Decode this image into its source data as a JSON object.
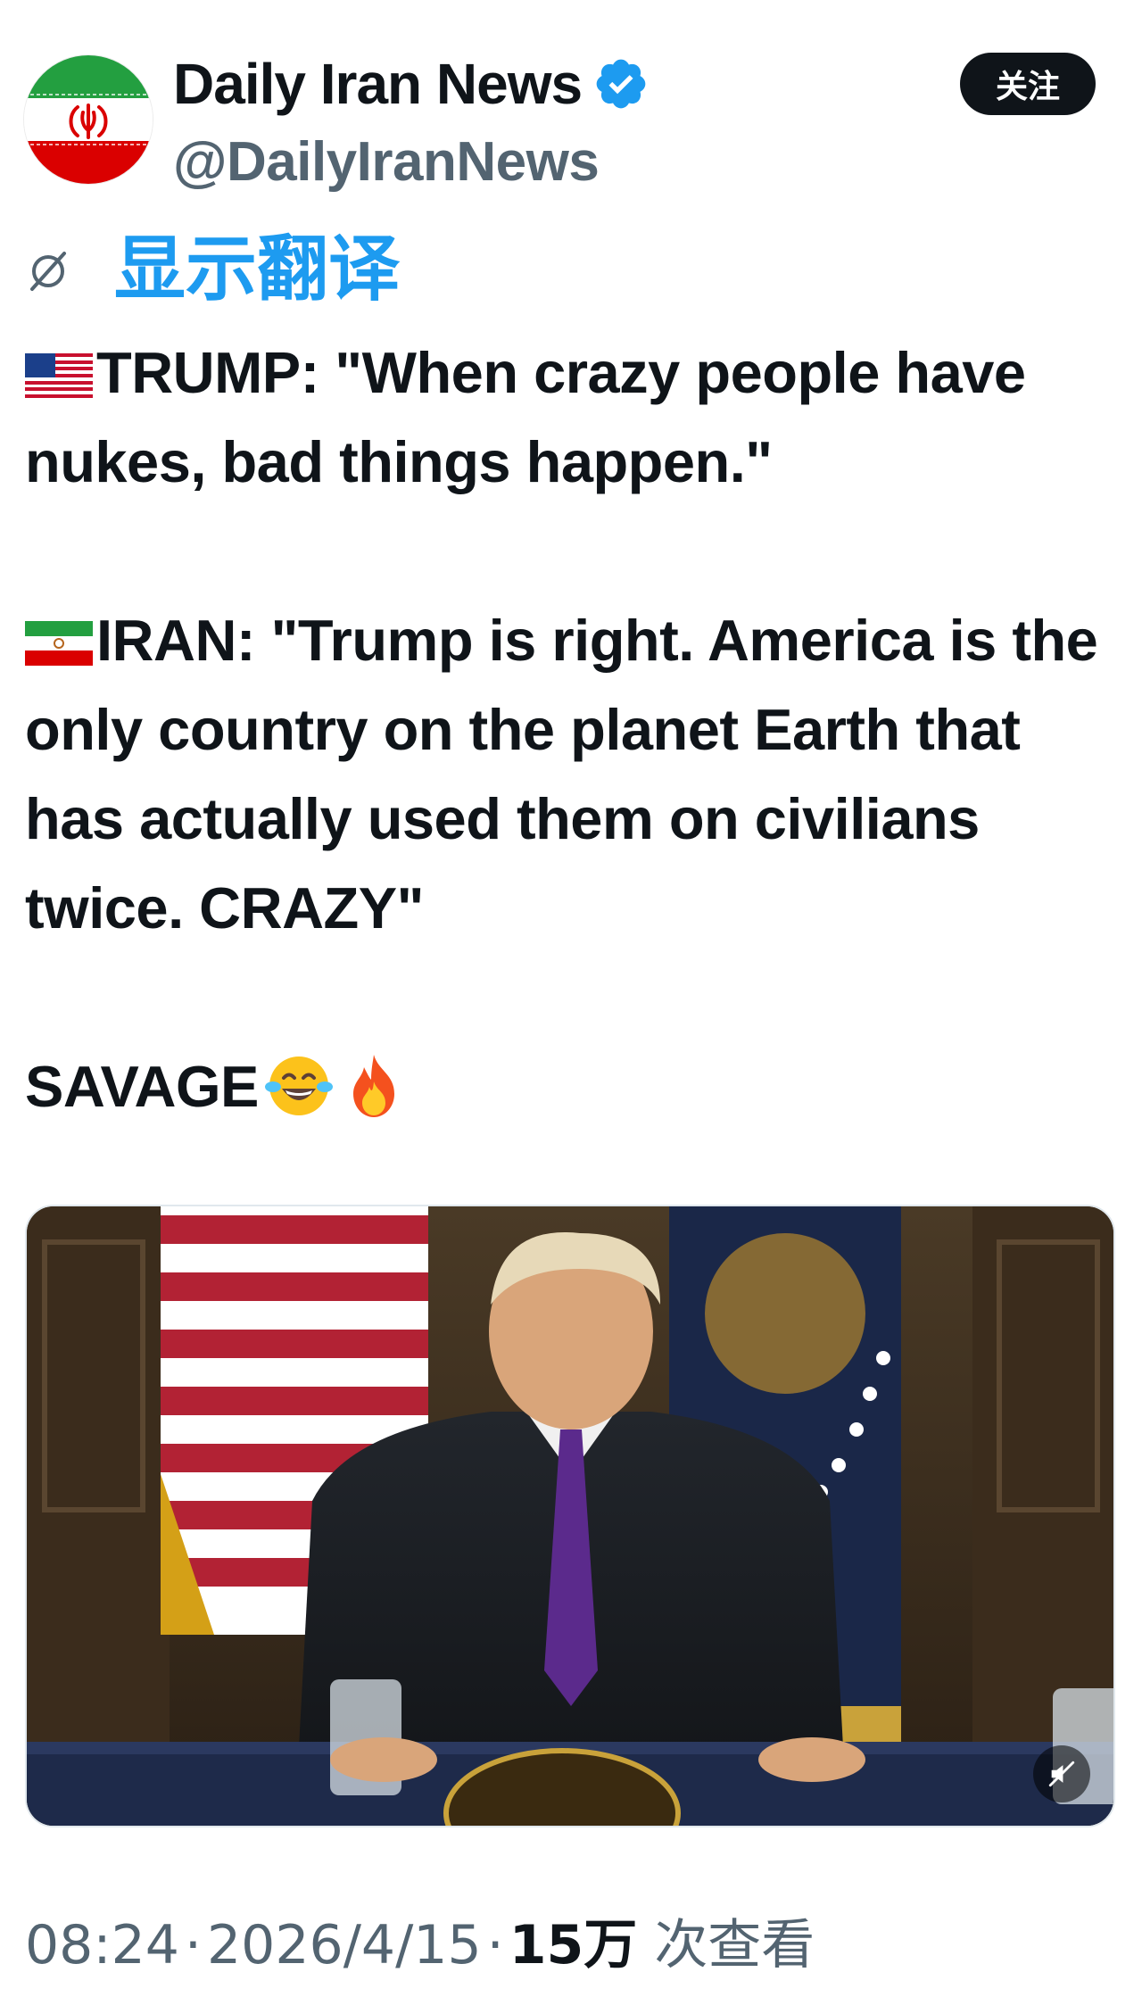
{
  "author": {
    "display_name": "Daily Iran News",
    "handle": "@DailyIranNews",
    "verified": true,
    "avatar_icon": "iran-flag-avatar"
  },
  "follow_label": "关注",
  "translate_label": "显示翻译",
  "tweet": {
    "line1_text": "TRUMP: \"When crazy people have nukes, bad things happen.\"",
    "line2_text": "IRAN: \"Trump is right. America is the only country on the planet Earth that has actually used them on civilians twice. CRAZY\"",
    "line3_text": "SAVAGE",
    "emojis": [
      "us-flag-emoji",
      "iran-flag-emoji",
      "laughing-tears-emoji",
      "fire-emoji"
    ]
  },
  "media": {
    "type": "video",
    "mute_icon": "muted-speaker-icon"
  },
  "meta": {
    "time": "08:24",
    "separator": "·",
    "date": "2026/4/15",
    "views_count": "15万",
    "views_label": "次查看"
  },
  "colors": {
    "accent": "#1d9bf0",
    "text": "#0f1419",
    "secondary": "#536471",
    "button_bg": "#0f1419"
  }
}
